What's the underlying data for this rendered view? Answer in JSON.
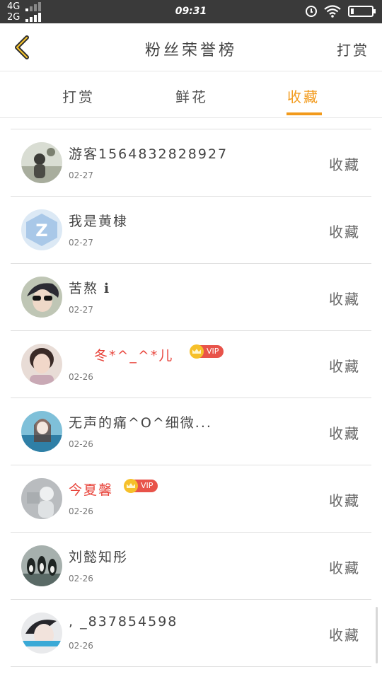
{
  "status_bar": {
    "network_1": "4G",
    "network_2": "2G",
    "time": "09:31",
    "icons": [
      "alarm-icon",
      "wifi-icon",
      "battery-icon"
    ]
  },
  "header": {
    "back_icon": "chevron-left-icon",
    "title": "粉丝荣誉榜",
    "action": "打赏"
  },
  "tabs": [
    {
      "label": "打赏",
      "active": false
    },
    {
      "label": "鲜花",
      "active": false
    },
    {
      "label": "收藏",
      "active": true
    }
  ],
  "accent_color": "#f29a1c",
  "vip_label": "VIP",
  "fans": [
    {
      "name": "游客1564832828927",
      "date": "02-27",
      "action": "收藏",
      "vip": false
    },
    {
      "name": "我是黄棣",
      "date": "02-27",
      "action": "收藏",
      "vip": false
    },
    {
      "name": "苦熬 ℹ",
      "date": "02-27",
      "action": "收藏",
      "vip": false
    },
    {
      "name": "冬*^_^*儿",
      "date": "02-26",
      "action": "收藏",
      "vip": true
    },
    {
      "name": "无声的痛^O^细微...",
      "date": "02-26",
      "action": "收藏",
      "vip": false
    },
    {
      "name": "今夏馨",
      "date": "02-26",
      "action": "收藏",
      "vip": true
    },
    {
      "name": "刘懿知彤",
      "date": "02-26",
      "action": "收藏",
      "vip": false
    },
    {
      "name": ", _837854598",
      "date": "02-26",
      "action": "收藏",
      "vip": false
    }
  ]
}
